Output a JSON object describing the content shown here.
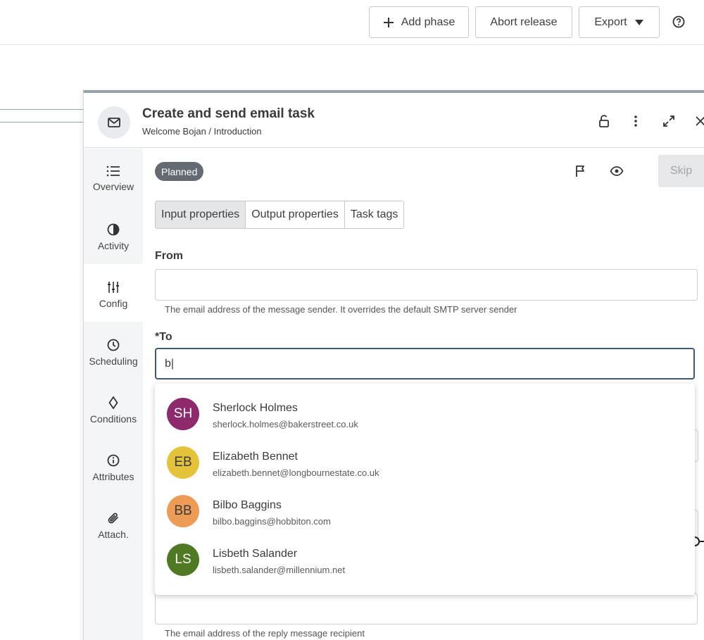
{
  "toolbar": {
    "add_phase": "Add phase",
    "abort_release": "Abort release",
    "export": "Export"
  },
  "task": {
    "title": "Create and send email task",
    "breadcrumb": "Welcome Bojan / Introduction",
    "status": "Planned",
    "skip": "Skip"
  },
  "sidenav": {
    "items": [
      {
        "label": "Overview",
        "icon": "list-icon"
      },
      {
        "label": "Activity",
        "icon": "activity-icon"
      },
      {
        "label": "Config",
        "icon": "sliders-icon"
      },
      {
        "label": "Scheduling",
        "icon": "clock-icon"
      },
      {
        "label": "Conditions",
        "icon": "diamond-icon"
      },
      {
        "label": "Attributes",
        "icon": "info-icon"
      },
      {
        "label": "Attach.",
        "icon": "paperclip-icon"
      }
    ],
    "active": "Config"
  },
  "tabs": [
    {
      "label": "Input properties"
    },
    {
      "label": "Output properties"
    },
    {
      "label": "Task tags"
    }
  ],
  "form": {
    "from_label": "From",
    "from_value": "",
    "from_hint": "The email address of the message sender. It overrides the default SMTP server sender",
    "to_label": "*To",
    "to_value": "b|",
    "reply_hint": "The email address of the reply message recipient"
  },
  "suggestions": [
    {
      "initials": "SH",
      "name": "Sherlock Holmes",
      "email": "sherlock.holmes@bakerstreet.co.uk",
      "color": "#8e2a6c",
      "text_color": "#ffffff"
    },
    {
      "initials": "EB",
      "name": "Elizabeth Bennet",
      "email": "elizabeth.bennet@longbournestate.co.uk",
      "color": "#e4c33a",
      "text_color": "#3a3a3a"
    },
    {
      "initials": "BB",
      "name": "Bilbo Baggins",
      "email": "bilbo.baggins@hobbiton.com",
      "color": "#ee9b55",
      "text_color": "#3a3a3a"
    },
    {
      "initials": "LS",
      "name": "Lisbeth Salander",
      "email": "lisbeth.salander@millennium.net",
      "color": "#4f7a23",
      "text_color": "#ffffff"
    }
  ]
}
